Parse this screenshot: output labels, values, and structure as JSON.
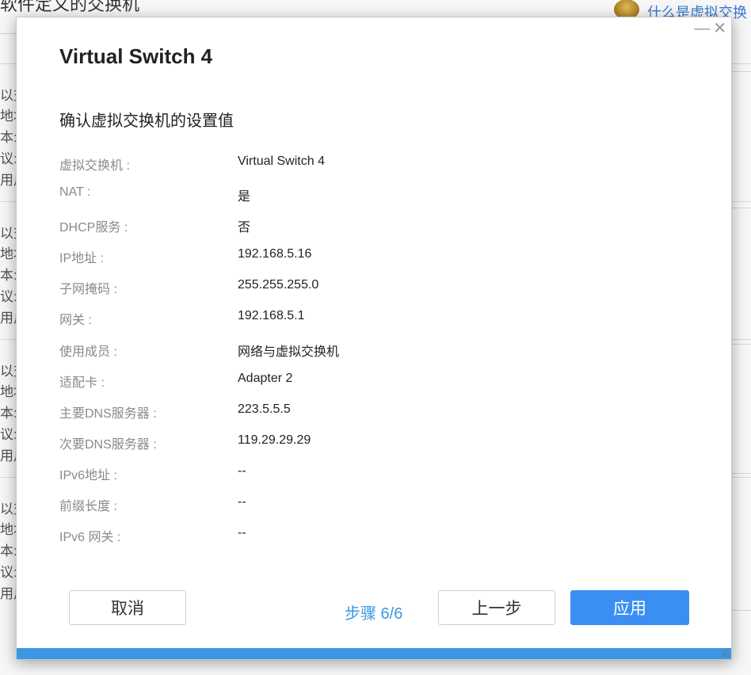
{
  "background": {
    "title_fragment": "软件定义的交换机",
    "help_link": "什么是虚拟交换",
    "row_fragments": [
      "以交",
      "地址",
      "本:",
      "议:",
      "用户"
    ]
  },
  "dialog": {
    "title": "Virtual Switch 4",
    "window_controls": {
      "minimize": "—",
      "close": "✕"
    },
    "section_title": "确认虚拟交换机的设置值",
    "rows": [
      {
        "label": "虚拟交换机 :",
        "value": "Virtual Switch 4"
      },
      {
        "label": "NAT :",
        "value": "是"
      },
      {
        "label": "DHCP服务 :",
        "value": "否"
      },
      {
        "label": "IP地址 :",
        "value": "192.168.5.16"
      },
      {
        "label": "子网掩码 :",
        "value": "255.255.255.0"
      },
      {
        "label": "网关 :",
        "value": "192.168.5.1"
      },
      {
        "label": "使用成员 :",
        "value": "网络与虚拟交换机"
      },
      {
        "label": "适配卡 :",
        "value": "Adapter 2"
      },
      {
        "label": "主要DNS服务器 :",
        "value": "223.5.5.5"
      },
      {
        "label": "次要DNS服务器 :",
        "value": "119.29.29.29"
      },
      {
        "label": "IPv6地址 :",
        "value": "--"
      },
      {
        "label": "前缀长度 :",
        "value": "--"
      },
      {
        "label": "IPv6 网关 :",
        "value": "--"
      }
    ],
    "buttons": {
      "cancel": "取消",
      "previous": "上一步",
      "apply": "应用"
    },
    "step_text": "步骤 6/6",
    "progress": {
      "fraction": 1.0
    },
    "colors": {
      "accent": "#3b8ff3",
      "step_text": "#3b97e3",
      "label": "#8a8a8a"
    }
  }
}
